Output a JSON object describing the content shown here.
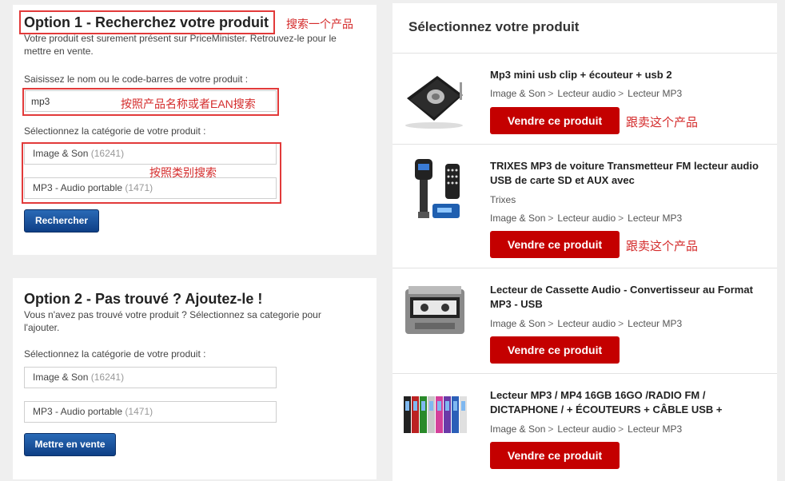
{
  "option1": {
    "title": "Option 1 - Recherchez votre produit",
    "desc": "Votre produit est surement présent sur PriceMinister. Retrouvez-le pour le mettre en vente.",
    "search_label": "Saisissez le nom ou le code-barres de votre produit :",
    "search_value": "mp3",
    "category_label": "Sélectionnez la catégorie de votre produit :",
    "category1": {
      "name": "Image & Son",
      "count": "(16241)"
    },
    "category2": {
      "name": "MP3 - Audio portable",
      "count": "(1471)"
    },
    "search_button": "Rechercher"
  },
  "annotations": {
    "search_product": "搜索一个产品",
    "by_name_ean": "按照产品名称或者EAN搜索",
    "by_category": "按照类别搜索",
    "follow_sell": "跟卖这个产品"
  },
  "option2": {
    "title": "Option 2 - Pas trouvé ? Ajoutez-le !",
    "desc": "Vous n'avez pas trouvé votre produit ? Sélectionnez sa categorie pour l'ajouter.",
    "category_label": "Sélectionnez la catégorie de votre produit :",
    "category1": {
      "name": "Image & Son",
      "count": "(16241)"
    },
    "category2": {
      "name": "MP3 - Audio portable",
      "count": "(1471)"
    },
    "sell_button": "Mettre en vente"
  },
  "results": {
    "title": "Sélectionnez votre produit",
    "sell_label": "Vendre ce produit",
    "items": [
      {
        "title": "Mp3 mini usb clip + écouteur + usb 2",
        "brand": "",
        "breadcrumb": [
          "Image & Son",
          "Lecteur audio",
          "Lecteur MP3"
        ]
      },
      {
        "title": "TRIXES MP3 de voiture Transmetteur FM lecteur audio USB de carte SD et AUX avec",
        "brand": "Trixes",
        "breadcrumb": [
          "Image & Son",
          "Lecteur audio",
          "Lecteur MP3"
        ]
      },
      {
        "title": "Lecteur de Cassette Audio - Convertisseur au Format MP3 - USB",
        "brand": "",
        "breadcrumb": [
          "Image & Son",
          "Lecteur audio",
          "Lecteur MP3"
        ]
      },
      {
        "title": "Lecteur MP3 / MP4 16GB 16GO /RADIO FM / DICTAPHONE / + ÉCOUTEURS + CÂBLE USB +",
        "brand": "",
        "breadcrumb": [
          "Image & Son",
          "Lecteur audio",
          "Lecteur MP3"
        ]
      }
    ]
  }
}
